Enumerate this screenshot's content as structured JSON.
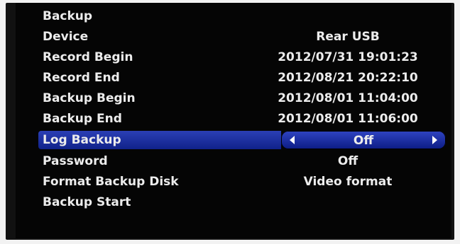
{
  "menu": {
    "title": "Backup",
    "rows": [
      {
        "label": "Device",
        "value": "Rear USB"
      },
      {
        "label": "Record Begin",
        "value": "2012/07/31 19:01:23"
      },
      {
        "label": "Record End",
        "value": "2012/08/21 20:22:10"
      },
      {
        "label": "Backup Begin",
        "value": "2012/08/01 11:04:00"
      },
      {
        "label": "Backup End",
        "value": "2012/08/01 11:06:00"
      },
      {
        "label": "Log Backup",
        "value": "Off"
      },
      {
        "label": "Password",
        "value": "Off"
      },
      {
        "label": "Format Backup Disk",
        "value": "Video format"
      },
      {
        "label": "Backup Start",
        "value": ""
      }
    ]
  },
  "colors": {
    "background": "#050505",
    "text": "#ececec",
    "highlight": "#1a2fa3"
  },
  "icons": {
    "left_arrow": "triangle-left-icon",
    "right_arrow": "triangle-right-icon"
  }
}
